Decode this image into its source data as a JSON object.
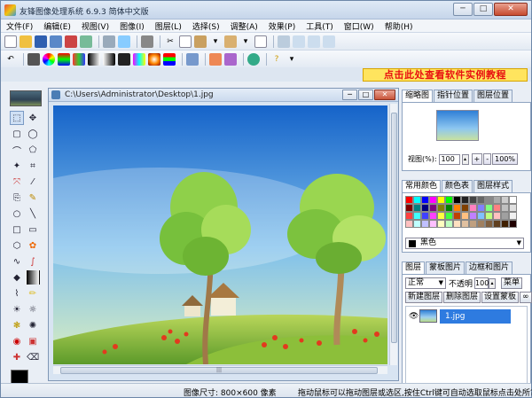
{
  "window": {
    "title": "友锋图像处理系统 6.9.3 简体中文版",
    "btn_min": "─",
    "btn_max": "□",
    "btn_close": "✕"
  },
  "menu": [
    "文件(F)",
    "编辑(E)",
    "视图(V)",
    "图像(I)",
    "图层(L)",
    "选择(S)",
    "调整(A)",
    "效果(P)",
    "工具(T)",
    "窗口(W)",
    "帮助(H)"
  ],
  "promo": "点击此处查看软件实例教程",
  "document": {
    "path": "C:\\Users\\Administrator\\Desktop\\1.jpg",
    "scroll_grip": "|||"
  },
  "navigator": {
    "tabs": [
      "缩略图",
      "指针位置",
      "图层位置"
    ],
    "zoom_label": "视图(%):",
    "zoom_value": "100",
    "plus": "+",
    "minus": "-",
    "zoom_100": "100%"
  },
  "colors_panel": {
    "tabs": [
      "常用颜色",
      "颜色表",
      "图层样式"
    ],
    "selected_color": "黑色",
    "swatches": [
      "#ff0000",
      "#00ffff",
      "#0000ff",
      "#ff00ff",
      "#ffff00",
      "#00ff00",
      "#000000",
      "#222222",
      "#444444",
      "#666666",
      "#888888",
      "#aaaaaa",
      "#cccccc",
      "#ffffff",
      "#800000",
      "#008080",
      "#000080",
      "#800080",
      "#808000",
      "#008000",
      "#ff8000",
      "#804000",
      "#ff80c0",
      "#8080ff",
      "#80ff80",
      "#ff8080",
      "#c0c0c0",
      "#e0e0e0",
      "#ff4040",
      "#40ffff",
      "#4040ff",
      "#ff40ff",
      "#ffff40",
      "#40ff40",
      "#c04000",
      "#ffc080",
      "#c080ff",
      "#80c0ff",
      "#c0ff80",
      "#ffc0c0",
      "#a0a0a0",
      "#f0f0f0",
      "#ffc0c0",
      "#c0ffff",
      "#c0c0ff",
      "#ffc0ff",
      "#ffffc0",
      "#c0ffc0",
      "#ffe0c0",
      "#e0c0a0",
      "#c0a080",
      "#a08060",
      "#806040",
      "#604020",
      "#402000",
      "#200000"
    ]
  },
  "layers_panel": {
    "tabs": [
      "图层",
      "蒙板图片",
      "边框和图片"
    ],
    "blend_mode": "正常",
    "opacity_label": "不透明",
    "opacity_value": "100",
    "mask_btn": "菜单",
    "btn_new": "新建图层",
    "btn_delete": "删除图层",
    "btn_mask": "设置蒙板",
    "btn_extra": "∞",
    "layer_name": "1.jpg"
  },
  "status": {
    "image_size": "图像尺寸: 800×600 像素",
    "hint": "拖动鼠标可以拖动图层或选区,按住Ctrl键可自动选取鼠标点击处所?"
  }
}
